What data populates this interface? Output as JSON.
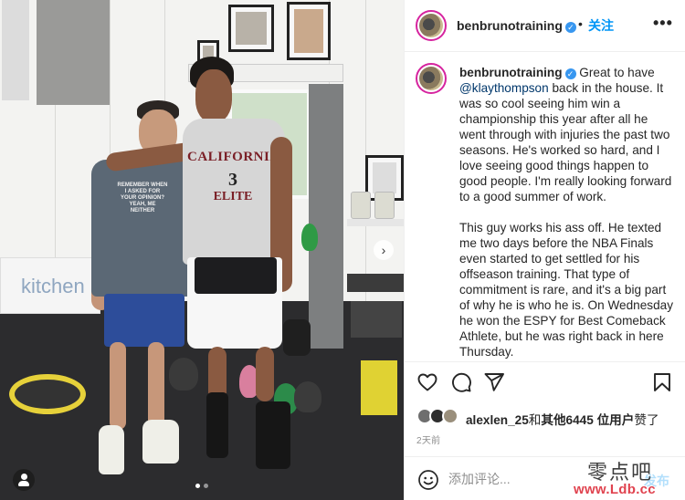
{
  "post": {
    "username": "benbrunotraining",
    "verified_glyph": "✓",
    "header_separator": "•",
    "follow_label": "关注",
    "more_glyph": "•••",
    "caption": {
      "username": "benbrunotraining",
      "intro": " Great to have ",
      "mention": "@klaythompson",
      "paragraph1_rest": " back in the house. It was so cool seeing him win a championship this year after all he went through with injuries the past two seasons. He's worked so hard, and I love seeing good things happen to good people. I'm really looking forward to a good summer of work.",
      "paragraph2": "This guy works his ass off. He texted me two days before the NBA Finals even started to get settled for his offseason training. That type of commitment is rare, and it's a big part of why he is who he is. On Wednesday he won the ESPY for Best Comeback Athlete, but he was right back in here Thursday."
    },
    "likes": {
      "user": "alexlen_25",
      "mid": "和",
      "others": "其他6445 位用户",
      "suffix": "赞了"
    },
    "time_ago": "2天前",
    "comment": {
      "placeholder": "添加评论...",
      "post_label": "发布"
    }
  },
  "photo": {
    "sign_text": "kitchen",
    "shirt_text": "REMEMBER WHEN I ASKED FOR YOUR OPINION? YEAH, ME NEITHER",
    "jersey_name": "CALIFORNIA",
    "jersey_number": "3",
    "jersey_sub": "ELITE",
    "next_glyph": "›",
    "carousel": {
      "count": 2,
      "active": 1
    }
  },
  "watermark": {
    "chinese": "零点吧",
    "url": "www.Ldb.cc"
  },
  "colors": {
    "link": "#00376b",
    "follow": "#0095f6",
    "verified": "#3897f0",
    "post_disabled": "#b2dffc",
    "watermark_url": "#e0434f"
  },
  "icons": [
    "heart-icon",
    "comment-icon",
    "share-icon",
    "bookmark-icon",
    "emoji-icon",
    "user-tag-icon",
    "chevron-right-icon",
    "more-icon",
    "verified-badge-icon"
  ]
}
